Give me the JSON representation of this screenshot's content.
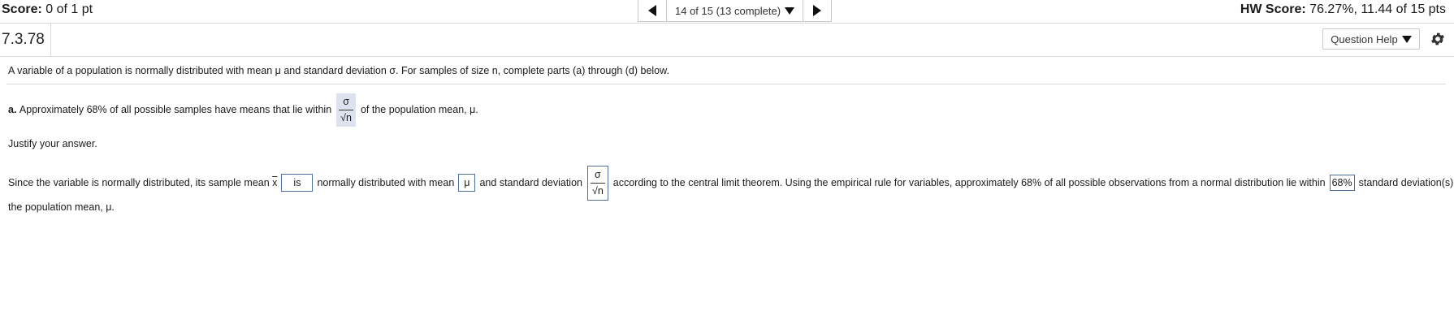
{
  "header": {
    "score_label": "Score:",
    "score_value": "0 of 1 pt",
    "nav_text": "14 of 15 (13 complete)",
    "hw_label": "HW Score:",
    "hw_value": "76.27%, 11.44 of 15 pts"
  },
  "question": {
    "number": "7.3.78",
    "help_label": "Question Help"
  },
  "body": {
    "intro": "A variable of a population is normally distributed with mean μ and standard deviation σ. For samples of size n, complete parts (a) through (d) below.",
    "part_a_label": "a.",
    "part_a_text": "Approximately 68% of all possible samples have means that lie within",
    "part_a_answer_num": "σ",
    "part_a_answer_den": "√n",
    "part_a_suffix": "of the population mean, μ.",
    "justify": "Justify your answer.",
    "j_text1": "Since the variable is normally distributed, its sample mean",
    "j_xbar": "x",
    "j_ans1": "is",
    "j_text2": "normally distributed with mean",
    "j_ans2": "μ",
    "j_text3": "and standard deviation",
    "j_ans3_num": "σ",
    "j_ans3_den": "√n",
    "j_text4": "according to the central limit theorem. Using the empirical rule for variables, approximately 68% of all possible observations from a normal distribution lie within",
    "j_ans4": "68%",
    "j_text5": "standard deviation(s) of",
    "j_text6": "the population mean, μ."
  },
  "icons": {
    "prev": "triangle-left-icon",
    "next": "triangle-right-icon",
    "dropdown": "caret-down-icon",
    "settings": "gear-icon"
  }
}
